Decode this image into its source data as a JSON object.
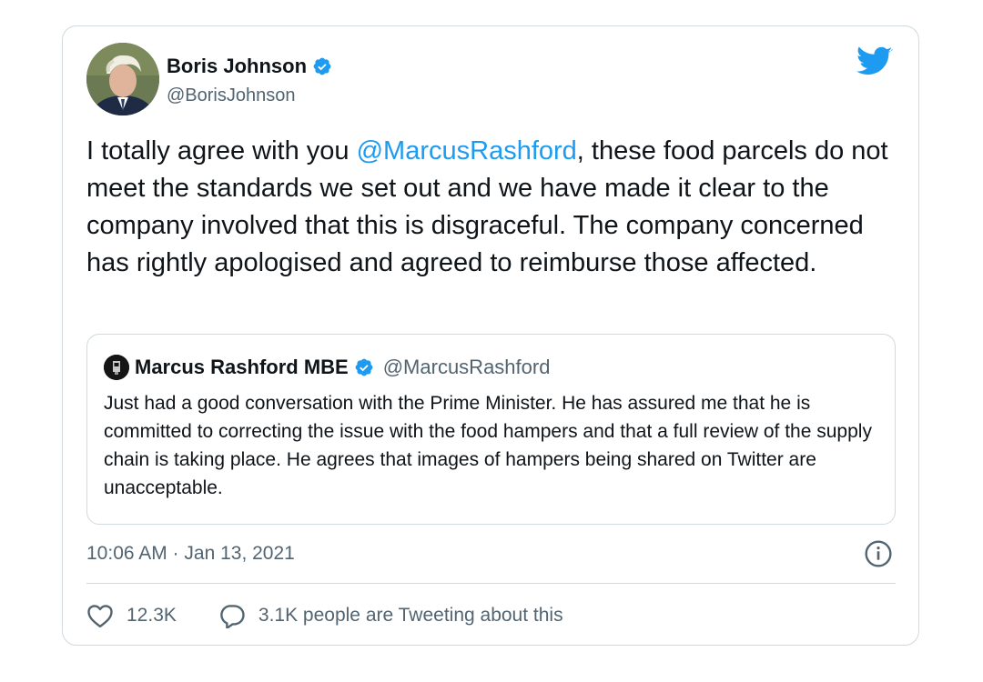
{
  "tweet": {
    "author": {
      "name": "Boris Johnson",
      "handle": "@BorisJohnson",
      "verified": true
    },
    "text_before_mention": "I totally agree with you ",
    "mention": "@MarcusRashford",
    "text_after_mention": ", these food parcels do not meet the standards we set out and we have made it clear to the company involved that this is disgraceful. The company concerned has rightly apologised and agreed to reimburse those affected.",
    "timestamp": "10:06 AM · Jan 13, 2021",
    "likes": "12.3K",
    "tweeting_about": "3.1K people are Tweeting about this"
  },
  "quoted_tweet": {
    "author": {
      "name": "Marcus Rashford MBE",
      "handle": "@MarcusRashford",
      "verified": true
    },
    "text": "Just had a good conversation with the Prime Minister. He has assured me that he is committed to correcting the issue with the food hampers and that a full review of the supply chain is taking place. He agrees that images of hampers being shared on Twitter are unacceptable."
  },
  "icons": {
    "brand": "twitter-bird-icon",
    "verified": "verified-badge-icon",
    "info": "info-icon",
    "like": "heart-icon",
    "reply": "speech-bubble-icon"
  },
  "colors": {
    "accent": "#1d9bf0",
    "text_primary": "#0f1419",
    "text_secondary": "#536471",
    "border": "#cfd9de"
  }
}
